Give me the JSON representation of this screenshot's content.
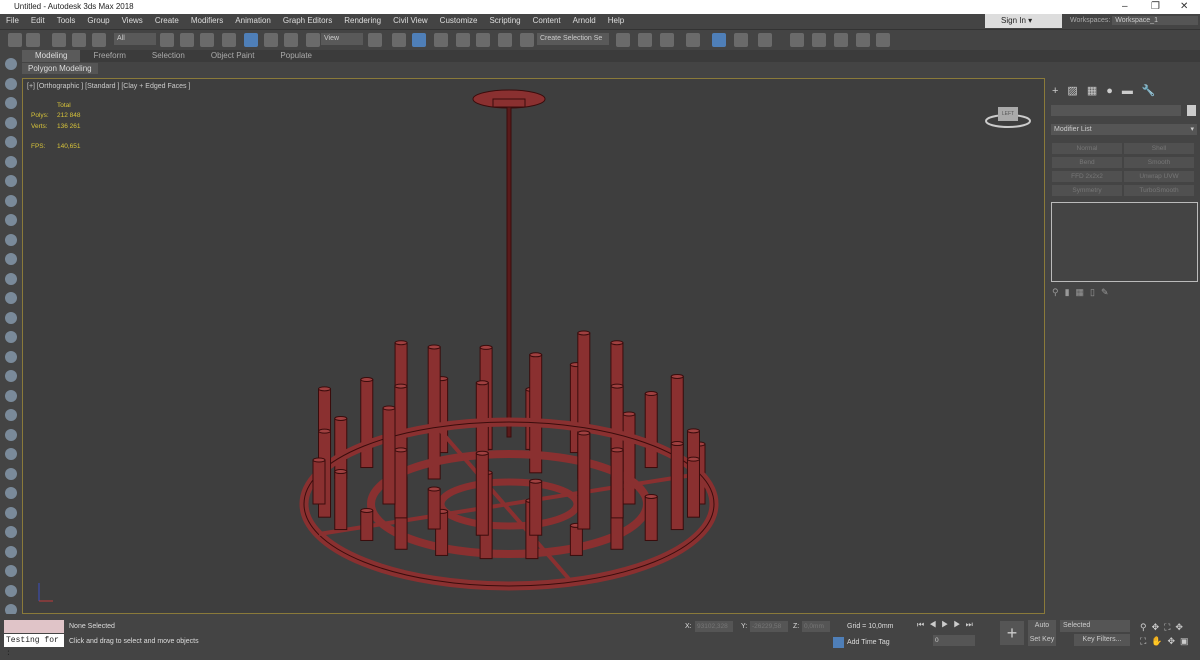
{
  "window": {
    "title": "Untitled - Autodesk 3ds Max 2018",
    "minimize": "–",
    "restore": "❐",
    "close": "✕"
  },
  "menu": [
    "File",
    "Edit",
    "Tools",
    "Group",
    "Views",
    "Create",
    "Modifiers",
    "Animation",
    "Graph Editors",
    "Rendering",
    "Civil View",
    "Customize",
    "Scripting",
    "Content",
    "Arnold",
    "Help"
  ],
  "account": {
    "sign_in": "Sign In",
    "workspaces_label": "Workspaces:",
    "workspace": "Workspace_1"
  },
  "toolbar": {
    "filter": "All",
    "ref_coord": "View",
    "selection_set": "Create Selection Se"
  },
  "ribbon": {
    "tabs": [
      "Modeling",
      "Freeform",
      "Selection",
      "Object Paint",
      "Populate"
    ],
    "active": "Modeling",
    "panel": "Polygon Modeling"
  },
  "viewport": {
    "label": "[+] [Orthographic ] [Standard ] [Clay + Edged Faces ]",
    "stats": {
      "header": "Total",
      "polys_label": "Polys:",
      "polys": "212 848",
      "verts_label": "Verts:",
      "verts": "136 261",
      "fps_label": "FPS:",
      "fps": "140,651"
    },
    "viewcube": "LEFT",
    "mesh_color": "#8a3030"
  },
  "command_panel": {
    "modifier_list": "Modifier List",
    "buttons": [
      "Normal",
      "Shell",
      "Bend",
      "Smooth",
      "FFD 2x2x2",
      "Unwrap UVW",
      "Symmetry",
      "TurboSmooth"
    ]
  },
  "status": {
    "maxscript": "Testing for :",
    "selection": "None Selected",
    "prompt": "Click and drag to select and move objects",
    "x_label": "X:",
    "x": "93102,328",
    "y_label": "Y:",
    "y": "-26229,58",
    "z_label": "Z:",
    "z": "0,0mm",
    "grid": "Grid = 10,0mm",
    "add_time_tag": "Add Time Tag",
    "frame": "0",
    "auto_key": "Auto Key",
    "set_key": "Set Key",
    "key_mode": "Selected",
    "key_filters": "Key Filters..."
  }
}
